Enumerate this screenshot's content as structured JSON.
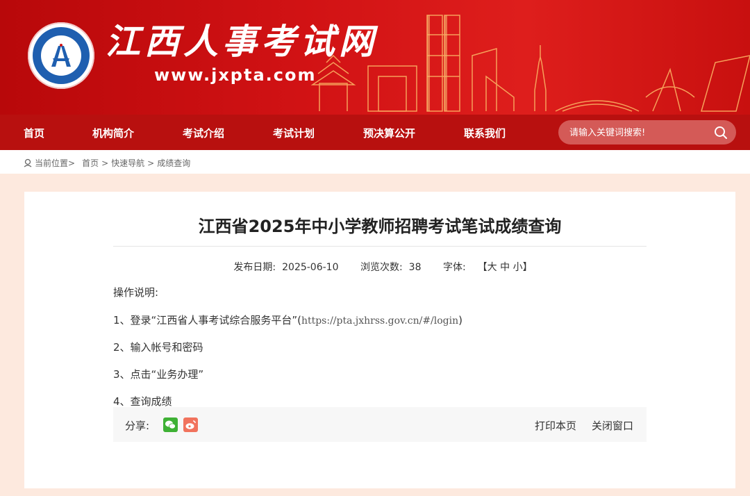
{
  "header": {
    "site_title": "江西人事考试网",
    "site_url": "www.jxpta.com"
  },
  "nav": {
    "items": [
      "首页",
      "机构简介",
      "考试介绍",
      "考试计划",
      "预决算公开",
      "联系我们"
    ],
    "search_placeholder": "请输入关键词搜索!"
  },
  "breadcrumb": {
    "prefix": "当前位置>",
    "items": [
      "首页",
      "快速导航",
      "成绩查询"
    ],
    "separator": ">"
  },
  "article": {
    "title": "江西省2025年中小学教师招聘考试笔试成绩查询",
    "publish_label": "发布日期:",
    "publish_date": "2025-06-10",
    "views_label": "浏览次数:",
    "views": "38",
    "font_label": "字体:",
    "font_sizes": "【大 中 小】",
    "instructions_heading": "操作说明:",
    "steps": [
      {
        "text": "1、登录“江西省人事考试综合服务平台”(",
        "url": "https://pta.jxhrss.gov.cn/#/login",
        "tail": ")"
      },
      {
        "text": "2、输入帐号和密码"
      },
      {
        "text": "3、点击“业务办理”"
      },
      {
        "text": "4、查询成绩"
      }
    ]
  },
  "share": {
    "label": "分享:",
    "print": "打印本页",
    "close": "关闭窗口"
  },
  "colors": {
    "banner_red": "#d11214",
    "nav_red": "#b8100f",
    "page_bg": "#fde9de",
    "wechat_green": "#3eb135",
    "weibo_orange": "#f1735d"
  }
}
